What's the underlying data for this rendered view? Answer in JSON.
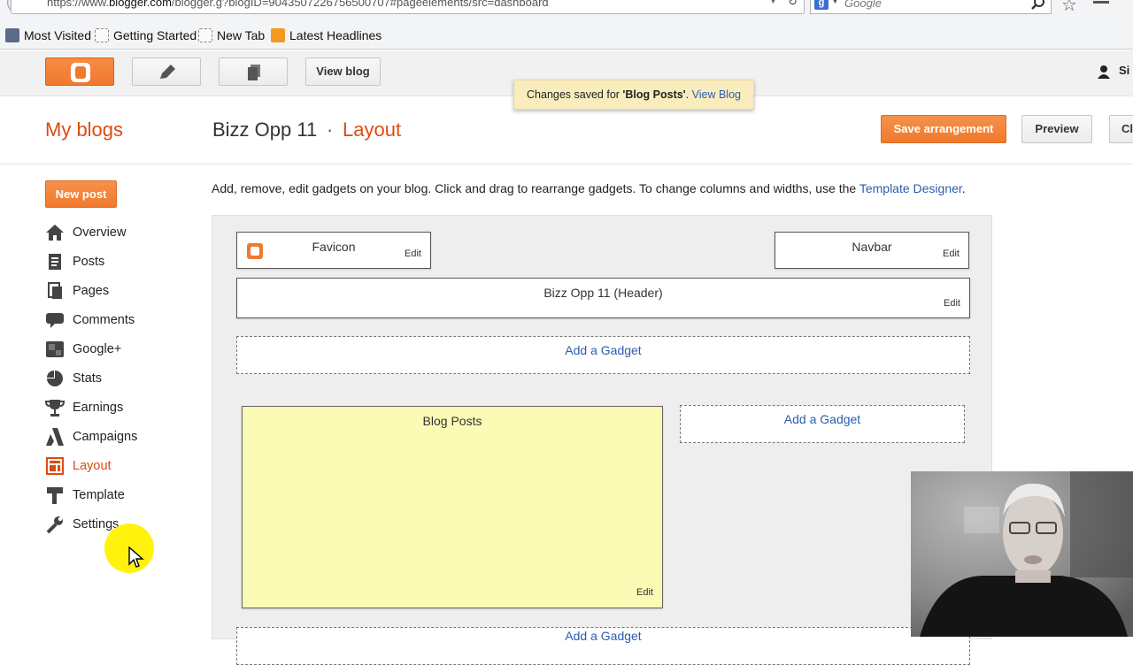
{
  "browser": {
    "url_prefix": "https://www.",
    "url_domain": "blogger.com",
    "url_rest": "/blogger.g?blogID=9043507226756500707#pageelements/src=dashboard",
    "search_placeholder": "Google",
    "bookmarks": [
      "Most Visited",
      "Getting Started",
      "New Tab",
      "Latest Headlines"
    ]
  },
  "header": {
    "view_blog_label": "View blog",
    "user_name": "Si"
  },
  "toast": {
    "prefix": "Changes saved for ",
    "item": "'Blog Posts'",
    "suffix": ". ",
    "link": "View Blog"
  },
  "titlebar": {
    "my_blogs": "My blogs",
    "blog_name": "Bizz Opp 11",
    "separator": "·",
    "page_name": "Layout",
    "save_label": "Save arrangement",
    "preview_label": "Preview",
    "clear_label": "Cl"
  },
  "sidebar": {
    "new_post_label": "New post",
    "items": [
      {
        "label": "Overview",
        "icon": "home-icon"
      },
      {
        "label": "Posts",
        "icon": "posts-icon"
      },
      {
        "label": "Pages",
        "icon": "pages-icon"
      },
      {
        "label": "Comments",
        "icon": "comments-icon"
      },
      {
        "label": "Google+",
        "icon": "google-plus-icon"
      },
      {
        "label": "Stats",
        "icon": "stats-icon"
      },
      {
        "label": "Earnings",
        "icon": "trophy-icon"
      },
      {
        "label": "Campaigns",
        "icon": "campaigns-icon"
      },
      {
        "label": "Layout",
        "icon": "layout-icon",
        "active": true
      },
      {
        "label": "Template",
        "icon": "template-icon"
      },
      {
        "label": "Settings",
        "icon": "wrench-icon"
      }
    ]
  },
  "content": {
    "intro_text": "Add, remove, edit gadgets on your blog. Click and drag to rearrange gadgets. To change columns and widths, use the ",
    "intro_link": "Template Designer",
    "intro_end": ".",
    "gadgets": {
      "favicon": {
        "title": "Favicon",
        "edit": "Edit"
      },
      "navbar": {
        "title": "Navbar",
        "edit": "Edit"
      },
      "header": {
        "title": "Bizz Opp 11 (Header)",
        "edit": "Edit"
      },
      "blog_posts": {
        "title": "Blog Posts",
        "edit": "Edit"
      }
    },
    "add_gadget_label": "Add a Gadget"
  },
  "colors": {
    "accent_orange": "#ef7a2e",
    "link_blue": "#2a5db0",
    "toast_bg": "#f9edbe",
    "blog_posts_bg": "#fbfbb6"
  }
}
